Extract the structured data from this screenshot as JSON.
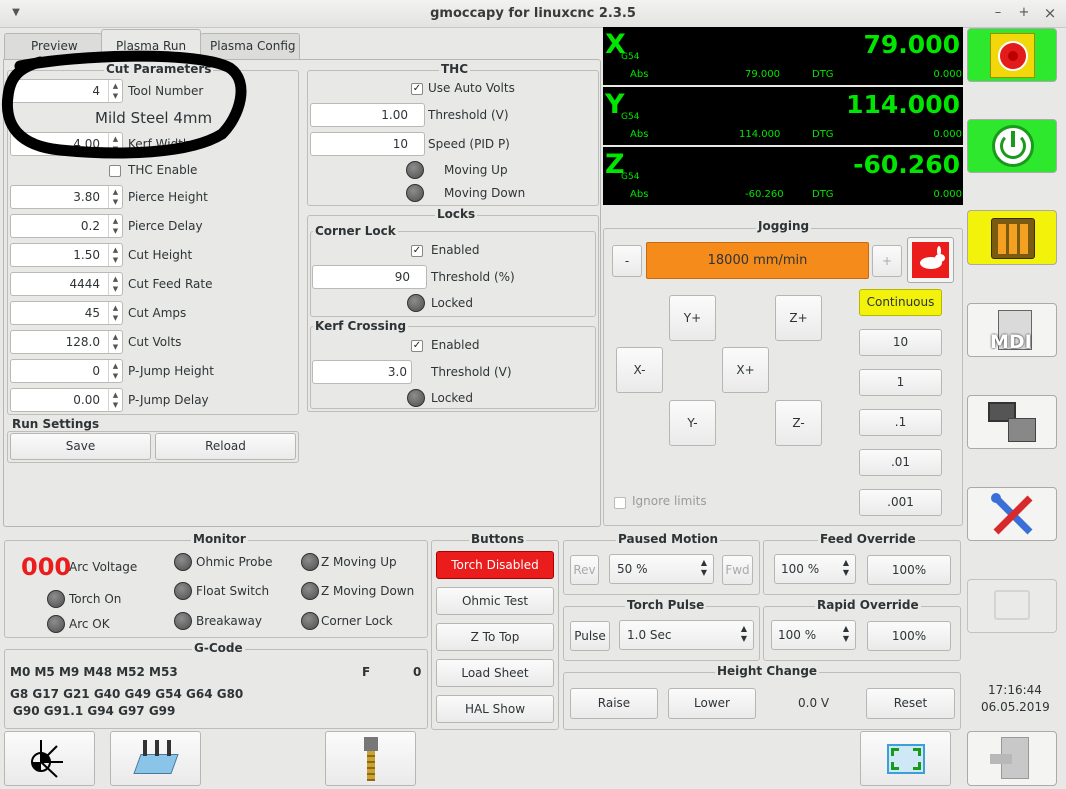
{
  "window": {
    "title": "gmoccapy for linuxcnc  2.3.5",
    "min": "–",
    "max": "+",
    "close": "×"
  },
  "tabs": [
    "Preview",
    "Plasma Run",
    "Plasma Config"
  ],
  "cut": {
    "title": "Cut Parameters",
    "tool_value": "4",
    "tool_label": "Tool Number",
    "material": "Mild Steel 4mm",
    "kerf_value": "4.00",
    "kerf_label": "Kerf Width",
    "thc_enable": "THC Enable",
    "rows": [
      {
        "v": "3.80",
        "l": "Pierce Height"
      },
      {
        "v": "0.2",
        "l": "Pierce Delay"
      },
      {
        "v": "1.50",
        "l": "Cut Height"
      },
      {
        "v": "4444",
        "l": "Cut Feed Rate"
      },
      {
        "v": "45",
        "l": "Cut Amps"
      },
      {
        "v": "128.0",
        "l": "Cut Volts"
      },
      {
        "v": "0",
        "l": "P-Jump Height"
      },
      {
        "v": "0.00",
        "l": "P-Jump Delay"
      }
    ]
  },
  "run": {
    "title": "Run Settings",
    "save": "Save",
    "reload": "Reload"
  },
  "thc": {
    "title": "THC",
    "auto": "Use Auto Volts",
    "thr_v": "1.00",
    "thr_l": "Threshold (V)",
    "spd_v": "10",
    "spd_l": "Speed (PID P)",
    "up": "Moving Up",
    "down": "Moving Down"
  },
  "locks": {
    "title": "Locks",
    "corner": "Corner Lock",
    "c_en": "Enabled",
    "c_thr_v": "90",
    "c_thr_l": "Threshold (%)",
    "c_locked": "Locked",
    "kerf": "Kerf Crossing",
    "k_en": "Enabled",
    "k_thr_v": "3.0",
    "k_thr_l": "Threshold (V)",
    "k_locked": "Locked"
  },
  "dro": [
    {
      "axis": "X",
      "off": "G54",
      "val": "79.000",
      "abs_l": "Abs",
      "abs_v": "79.000",
      "dtg_l": "DTG",
      "dtg_v": "0.000"
    },
    {
      "axis": "Y",
      "off": "G54",
      "val": "114.000",
      "abs_l": "Abs",
      "abs_v": "114.000",
      "dtg_l": "DTG",
      "dtg_v": "0.000"
    },
    {
      "axis": "Z",
      "off": "G54",
      "val": "-60.260",
      "abs_l": "Abs",
      "abs_v": "-60.260",
      "dtg_l": "DTG",
      "dtg_v": "0.000"
    }
  ],
  "jog": {
    "title": "Jogging",
    "minus": "-",
    "plus": "+",
    "speed": "18000 mm/min",
    "yp": "Y+",
    "zp": "Z+",
    "xm": "X-",
    "xp": "X+",
    "ym": "Y-",
    "zm": "Z-",
    "ignore": "Ignore limits",
    "incr": [
      "Continuous",
      "10",
      "1",
      ".1",
      ".01",
      ".001"
    ]
  },
  "monitor": {
    "title": "Monitor",
    "arc_num": "000",
    "arc_label": "Arc Voltage",
    "torch_on": "Torch On",
    "arc_ok": "Arc OK",
    "ohmic": "Ohmic Probe",
    "float": "Float Switch",
    "break": "Breakaway",
    "zup": "Z Moving Up",
    "zdown": "Z Moving Down",
    "corner": "Corner Lock"
  },
  "buttons": {
    "title": "Buttons",
    "torch": "Torch Disabled",
    "ohmic": "Ohmic Test",
    "ztop": "Z To Top",
    "load": "Load Sheet",
    "hal": "HAL Show"
  },
  "paused": {
    "title": "Paused Motion",
    "rev": "Rev",
    "pct": "50 %",
    "fwd": "Fwd"
  },
  "feed": {
    "title": "Feed Override",
    "pct": "100 %",
    "btn": "100%"
  },
  "pulse": {
    "title": "Torch Pulse",
    "btn": "Pulse",
    "time": "1.0 Sec"
  },
  "rapid": {
    "title": "Rapid Override",
    "pct": "100 %",
    "btn": "100%"
  },
  "height": {
    "title": "Height Change",
    "raise": "Raise",
    "lower": "Lower",
    "volts": "0.0 V",
    "reset": "Reset"
  },
  "gcode": {
    "title": "G-Code",
    "line1": "M0 M5 M9 M48 M52 M53",
    "f_label": "F",
    "f_val": "0",
    "line2": "G8 G17 G21 G40 G49 G54 G64 G80",
    "line3": "G90 G91.1 G94 G97 G99"
  },
  "side": {
    "mdi": "MDI",
    "time": "17:16:44",
    "date": "06.05.2019"
  },
  "colors": {
    "green": "#2ee82e",
    "yellow": "#f2f20a",
    "orange": "#f58b1a",
    "red": "#ea1c1c",
    "dro_green": "#00e600"
  }
}
